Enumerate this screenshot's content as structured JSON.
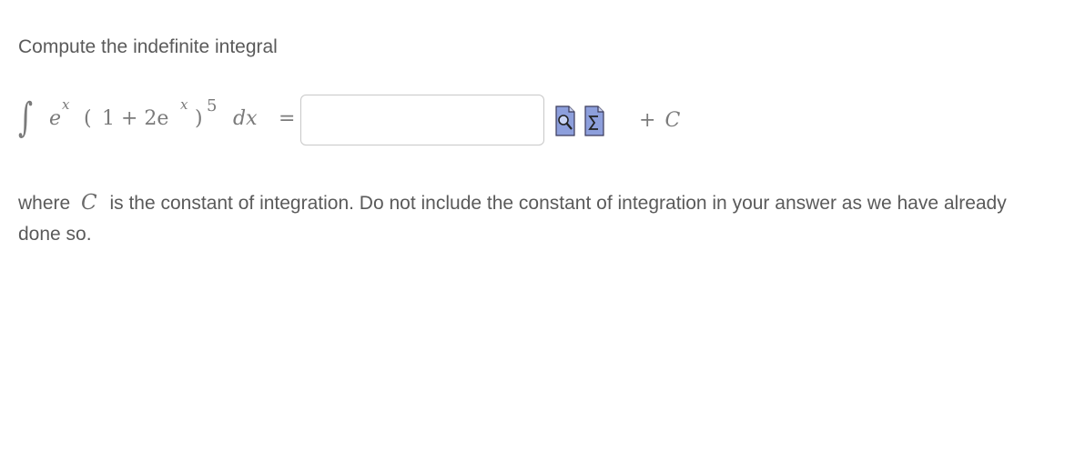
{
  "question": {
    "prompt": "Compute the indefinite integral",
    "expression": {
      "integral": "∫",
      "e1": "e",
      "x1": "x",
      "paren_open": "(",
      "base": "1 + 2e",
      "x2": "x",
      "paren_close": ")",
      "exponent": "5",
      "dx": "dx",
      "equals": "="
    },
    "answer": {
      "value": "",
      "placeholder": ""
    },
    "plus": "+",
    "constant": "C",
    "note_before": "where ",
    "note_after": " is the constant of integration. Do not include the constant of integration in your answer as we have already done so."
  },
  "icons": {
    "preview": "preview-magnifier-icon",
    "equation_editor": "sigma-equation-icon"
  },
  "colors": {
    "text": "#5a5a5a",
    "math": "#7a7a7a",
    "input_border": "#c8c8c8",
    "icon_blue": "#7d8fd6"
  }
}
